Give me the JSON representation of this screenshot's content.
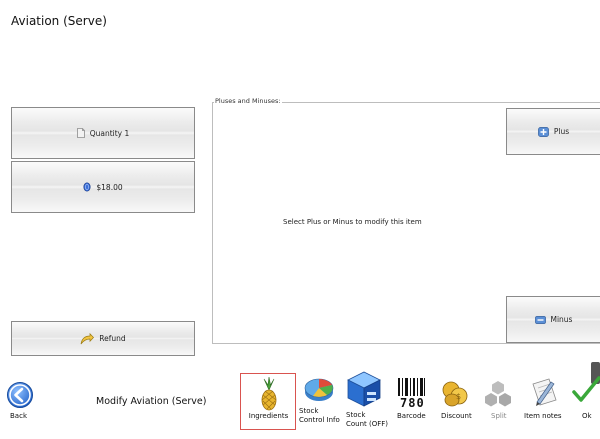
{
  "window": {
    "title": "Aviation (Serve)"
  },
  "left_panel": {
    "quantity_label": "Quantity 1",
    "price_label": "$18.00",
    "refund_label": "Refund"
  },
  "pluses_minuses": {
    "group_label": "Pluses and Minuses:",
    "message": "Select Plus or Minus to modify this item",
    "plus_label": "Plus",
    "minus_label": "Minus"
  },
  "footer": {
    "back_label": "Back",
    "modify_label": "Modify Aviation (Serve)"
  },
  "toolbar": {
    "ingredients": "Ingredients",
    "stock_control_line1": "Stock",
    "stock_control_line2": "Control Info",
    "stock_count_line1": "Stock",
    "stock_count_line2": "Count (OFF)",
    "barcode_digits": "780",
    "barcode": "Barcode",
    "discount": "Discount",
    "split": "Split",
    "item_notes": "Item notes",
    "ok": "Ok"
  },
  "colors": {
    "selected_border": "#d9534f",
    "back_blue": "#2a6bd6",
    "ok_green": "#3aa83a"
  }
}
